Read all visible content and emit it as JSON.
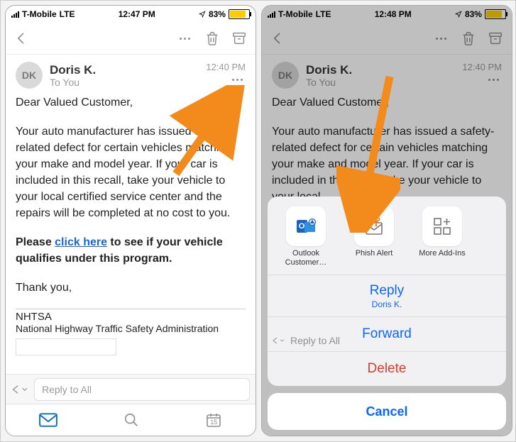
{
  "left": {
    "status": {
      "carrier": "T-Mobile",
      "net": "LTE",
      "time": "12:47 PM",
      "battery": "83%"
    },
    "sender": {
      "initials": "DK",
      "name": "Doris K.",
      "recipient": "To You",
      "time": "12:40 PM"
    },
    "body": {
      "greeting": "Dear Valued Customer,",
      "p1": "Your auto manufacturer has issued a safety-related defect for certain vehicles matching your make and model year. If your car is included in this recall, take your vehicle to your local certified service center and the repairs will be completed at no cost to you.",
      "cta_pre": "Please ",
      "cta_link": "click here",
      "cta_post": " to see if your vehicle qualifies under this program.",
      "thanks": "Thank you,",
      "sig1": "NHTSA",
      "sig2": "National Highway Traffic Safety Administration"
    },
    "reply_placeholder": "Reply to All",
    "calendar_day": "15"
  },
  "right": {
    "status": {
      "carrier": "T-Mobile",
      "net": "LTE",
      "time": "12:48 PM",
      "battery": "83%"
    },
    "sender": {
      "initials": "DK",
      "name": "Doris K.",
      "recipient": "To You",
      "time": "12:40 PM"
    },
    "body": {
      "greeting": "Dear Valued Customer,",
      "p1": "Your auto manufacturer has issued a safety-related defect for certain vehicles matching your make and model year. If your car is included in this recall, take your vehicle to your local"
    },
    "sheet": {
      "addins": [
        {
          "label": "Outlook Customer…"
        },
        {
          "label": "Phish Alert"
        },
        {
          "label": "More Add-Ins"
        }
      ],
      "reply": "Reply",
      "reply_sub": "Doris K.",
      "forward": "Forward",
      "delete": "Delete",
      "cancel": "Cancel"
    },
    "reply_ghost": "Reply to All"
  }
}
